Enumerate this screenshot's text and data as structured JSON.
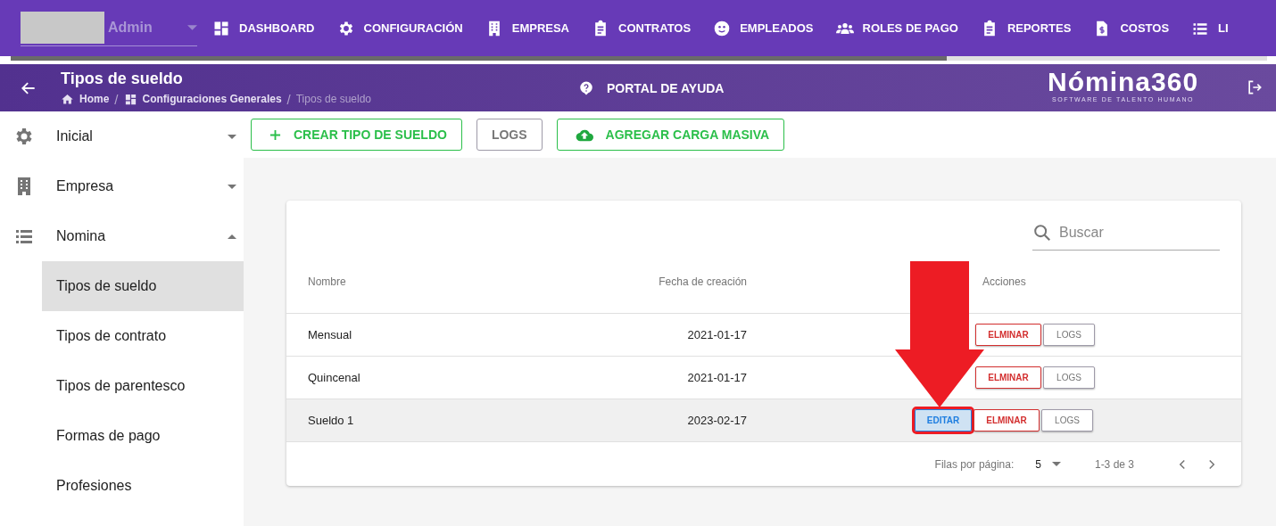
{
  "topbar": {
    "account": {
      "value": "Admin"
    },
    "nav": [
      {
        "label": "DASHBOARD"
      },
      {
        "label": "CONFIGURACIÓN"
      },
      {
        "label": "EMPRESA"
      },
      {
        "label": "CONTRATOS"
      },
      {
        "label": "EMPLEADOS"
      },
      {
        "label": "ROLES DE PAGO"
      },
      {
        "label": "REPORTES"
      },
      {
        "label": "COSTOS"
      },
      {
        "label": "LI"
      }
    ],
    "loading_bar": {
      "level": 0.745
    }
  },
  "header": {
    "title": "Tipos de sueldo",
    "breadcrumbs": [
      {
        "label": "Home"
      },
      {
        "separator": "/",
        "label": "Configuraciones Generales"
      },
      {
        "separator": "/",
        "label": "Tipos de sueldo"
      }
    ],
    "help": "PORTAL DE AYUDA",
    "logo": "Nómina360",
    "logo_tagline": "SOFTWARE DE TALENTO HUMANO"
  },
  "sidebar": {
    "items": [
      {
        "label": "Inicial",
        "expanded": false
      },
      {
        "label": "Empresa",
        "expanded": false
      },
      {
        "label": "Nomina",
        "expanded": true,
        "children": [
          {
            "label": "Tipos de sueldo",
            "selected": true
          },
          {
            "label": "Tipos de contrato",
            "selected": false
          },
          {
            "label": "Tipos de parentesco",
            "selected": false
          },
          {
            "label": "Formas de pago",
            "selected": false
          },
          {
            "label": "Profesiones",
            "selected": false
          }
        ]
      }
    ]
  },
  "toolbar": [
    {
      "label": "CREAR TIPO DE SUELDO",
      "kind": "create"
    },
    {
      "label": "LOGS",
      "kind": "plain"
    },
    {
      "label": "AGREGAR CARGA MASIVA",
      "kind": "upload"
    }
  ],
  "table": {
    "search": {
      "placeholder": "Buscar"
    },
    "columns": [
      "Nombre",
      "Fecha de creación",
      "Acciones"
    ],
    "rows": [
      {
        "name": "Mensual",
        "date": "2021-01-17",
        "hovered": false,
        "actions": [
          {
            "label": "ELMINAR",
            "kind": "delete"
          },
          {
            "label": "LOGS",
            "kind": "logs"
          }
        ]
      },
      {
        "name": "Quincenal",
        "date": "2021-01-17",
        "hovered": false,
        "actions": [
          {
            "label": "ELMINAR",
            "kind": "delete"
          },
          {
            "label": "LOGS",
            "kind": "logs"
          }
        ]
      },
      {
        "name": "Sueldo 1",
        "date": "2023-02-17",
        "hovered": true,
        "actions": [
          {
            "label": "EDITAR",
            "kind": "edit",
            "highlighted": true
          },
          {
            "label": "ELMINAR",
            "kind": "delete"
          },
          {
            "label": "LOGS",
            "kind": "logs"
          }
        ]
      }
    ],
    "footer": {
      "rows_label": "Filas por página:",
      "rows_value": "5",
      "range": "1-3 de 3"
    }
  },
  "annotation": {
    "kind": "arrow"
  }
}
